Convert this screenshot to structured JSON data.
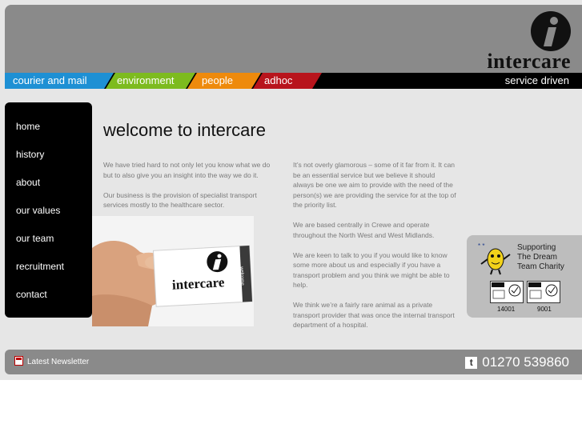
{
  "brand": {
    "name": "intercare",
    "tagline": "service driven"
  },
  "nav": {
    "tabs": [
      {
        "label": "courier and mail",
        "color": "#1e90d4"
      },
      {
        "label": "environment",
        "color": "#7dbb1f"
      },
      {
        "label": "people",
        "color": "#ee8a0c"
      },
      {
        "label": "adhoc",
        "color": "#b8141c"
      }
    ]
  },
  "sidebar": {
    "items": [
      {
        "label": "home"
      },
      {
        "label": "history"
      },
      {
        "label": "about"
      },
      {
        "label": "our values"
      },
      {
        "label": "our team"
      },
      {
        "label": "recruitment"
      },
      {
        "label": "contact"
      }
    ]
  },
  "main": {
    "title": "welcome to intercare",
    "left_paragraphs": [
      "We have tried hard to not only let you know what we do but to also give you an insight into the way we do it.",
      "Our business is the provision of specialist transport services mostly to the healthcare sector."
    ],
    "right_paragraphs": [
      "It’s not overly glamorous – some of it far from it. It can be an essential service but we believe it should always be one we aim to provide with the need of the person(s) we are providing the service for at the top of the priority list.",
      "We are based centrally in Crewe and operate throughout the North West and West Midlands.",
      "We are keen to talk to you if you would like to know some more about us and especially if you have a transport problem and you think we might be able to help.",
      "We think we’re a fairly rare animal as a private transport provider that was once the internal transport department of a hospital."
    ],
    "photo": {
      "card_brand": "intercare",
      "card_side": "welcome"
    }
  },
  "charity": {
    "line1": "Supporting",
    "line2": "The Dream",
    "line3": "Team Charity",
    "iso1": "14001",
    "iso2": "9001"
  },
  "footer": {
    "newsletter": "Latest Newsletter",
    "phone_icon": "t",
    "phone": "01270 539860"
  }
}
